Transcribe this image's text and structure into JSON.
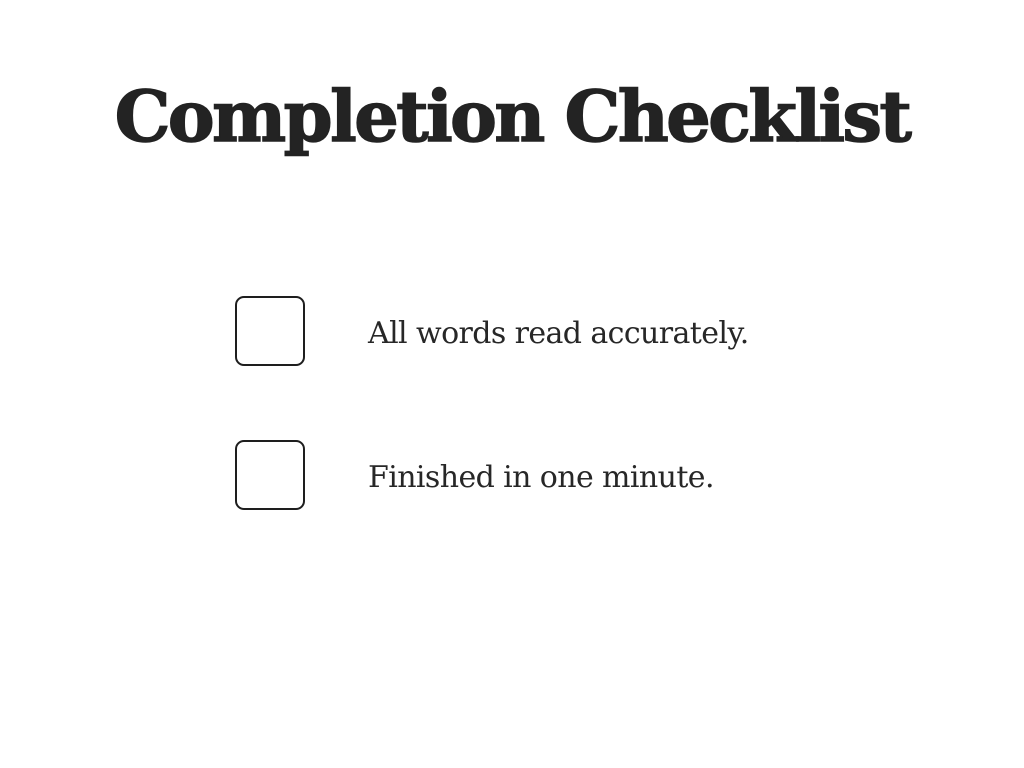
{
  "page": {
    "title": "Completion Checklist",
    "text_color": "#242424",
    "background_color": "#ffffff"
  },
  "checklist": {
    "items": [
      {
        "label": "All words read accurately.",
        "checked": false
      },
      {
        "label": "Finished in one minute.",
        "checked": false
      }
    ]
  }
}
